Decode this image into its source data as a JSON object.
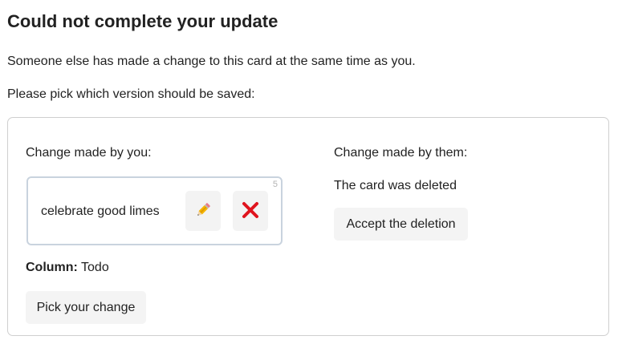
{
  "header": {
    "title": "Could not complete your update",
    "subtitle": "Someone else has made a change to this card at the same time as you.",
    "instruction": "Please pick which version should be saved:"
  },
  "mine": {
    "heading": "Change made by you:",
    "card": {
      "text": "celebrate good limes",
      "count": "5",
      "edit_icon": "pencil-icon",
      "delete_icon": "red-x-icon"
    },
    "column_label": "Column:",
    "column_value": "Todo",
    "pick_button": "Pick your change"
  },
  "theirs": {
    "heading": "Change made by them:",
    "status": "The card was deleted",
    "accept_button": "Accept the deletion"
  },
  "colors": {
    "delete_red": "#e0141e",
    "pencil_yellow": "#f5b400",
    "card_border": "#c9d3de"
  }
}
